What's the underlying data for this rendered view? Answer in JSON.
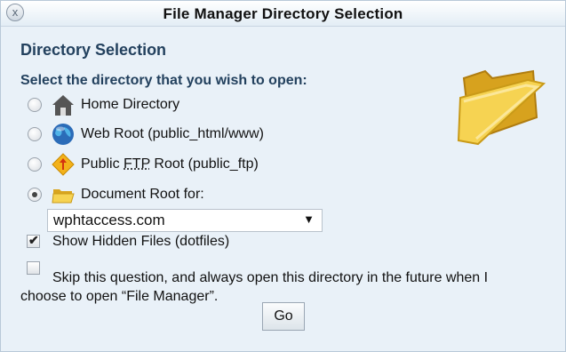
{
  "window": {
    "title": "File Manager Directory Selection",
    "close_glyph": "x"
  },
  "section": {
    "heading": "Directory Selection",
    "prompt": "Select the directory that you wish to open:"
  },
  "options": [
    {
      "label": "Home Directory",
      "icon": "home-icon",
      "checked": false
    },
    {
      "label_pre": "Web Root (public_html/www)",
      "icon": "globe-icon",
      "checked": false
    },
    {
      "label_pre": "Public ",
      "label_ul": "FTP",
      "label_post": " Root (public_ftp)",
      "icon": "ftp-icon",
      "checked": false
    },
    {
      "label": "Document Root for:",
      "icon": "folder-icon",
      "checked": true
    }
  ],
  "domain_select": {
    "value": "wphtaccess.com",
    "caret": "▼"
  },
  "show_hidden": {
    "label": "Show Hidden Files (dotfiles)",
    "checked": true,
    "mark": "✔"
  },
  "skip": {
    "label": "Skip this question, and always open this directory in the future when I choose to open “File Manager”.",
    "checked": false
  },
  "go_button": {
    "label": "Go"
  },
  "colors": {
    "heading": "#23415e",
    "background": "#e9f1f8",
    "folder": "#f4c842"
  }
}
